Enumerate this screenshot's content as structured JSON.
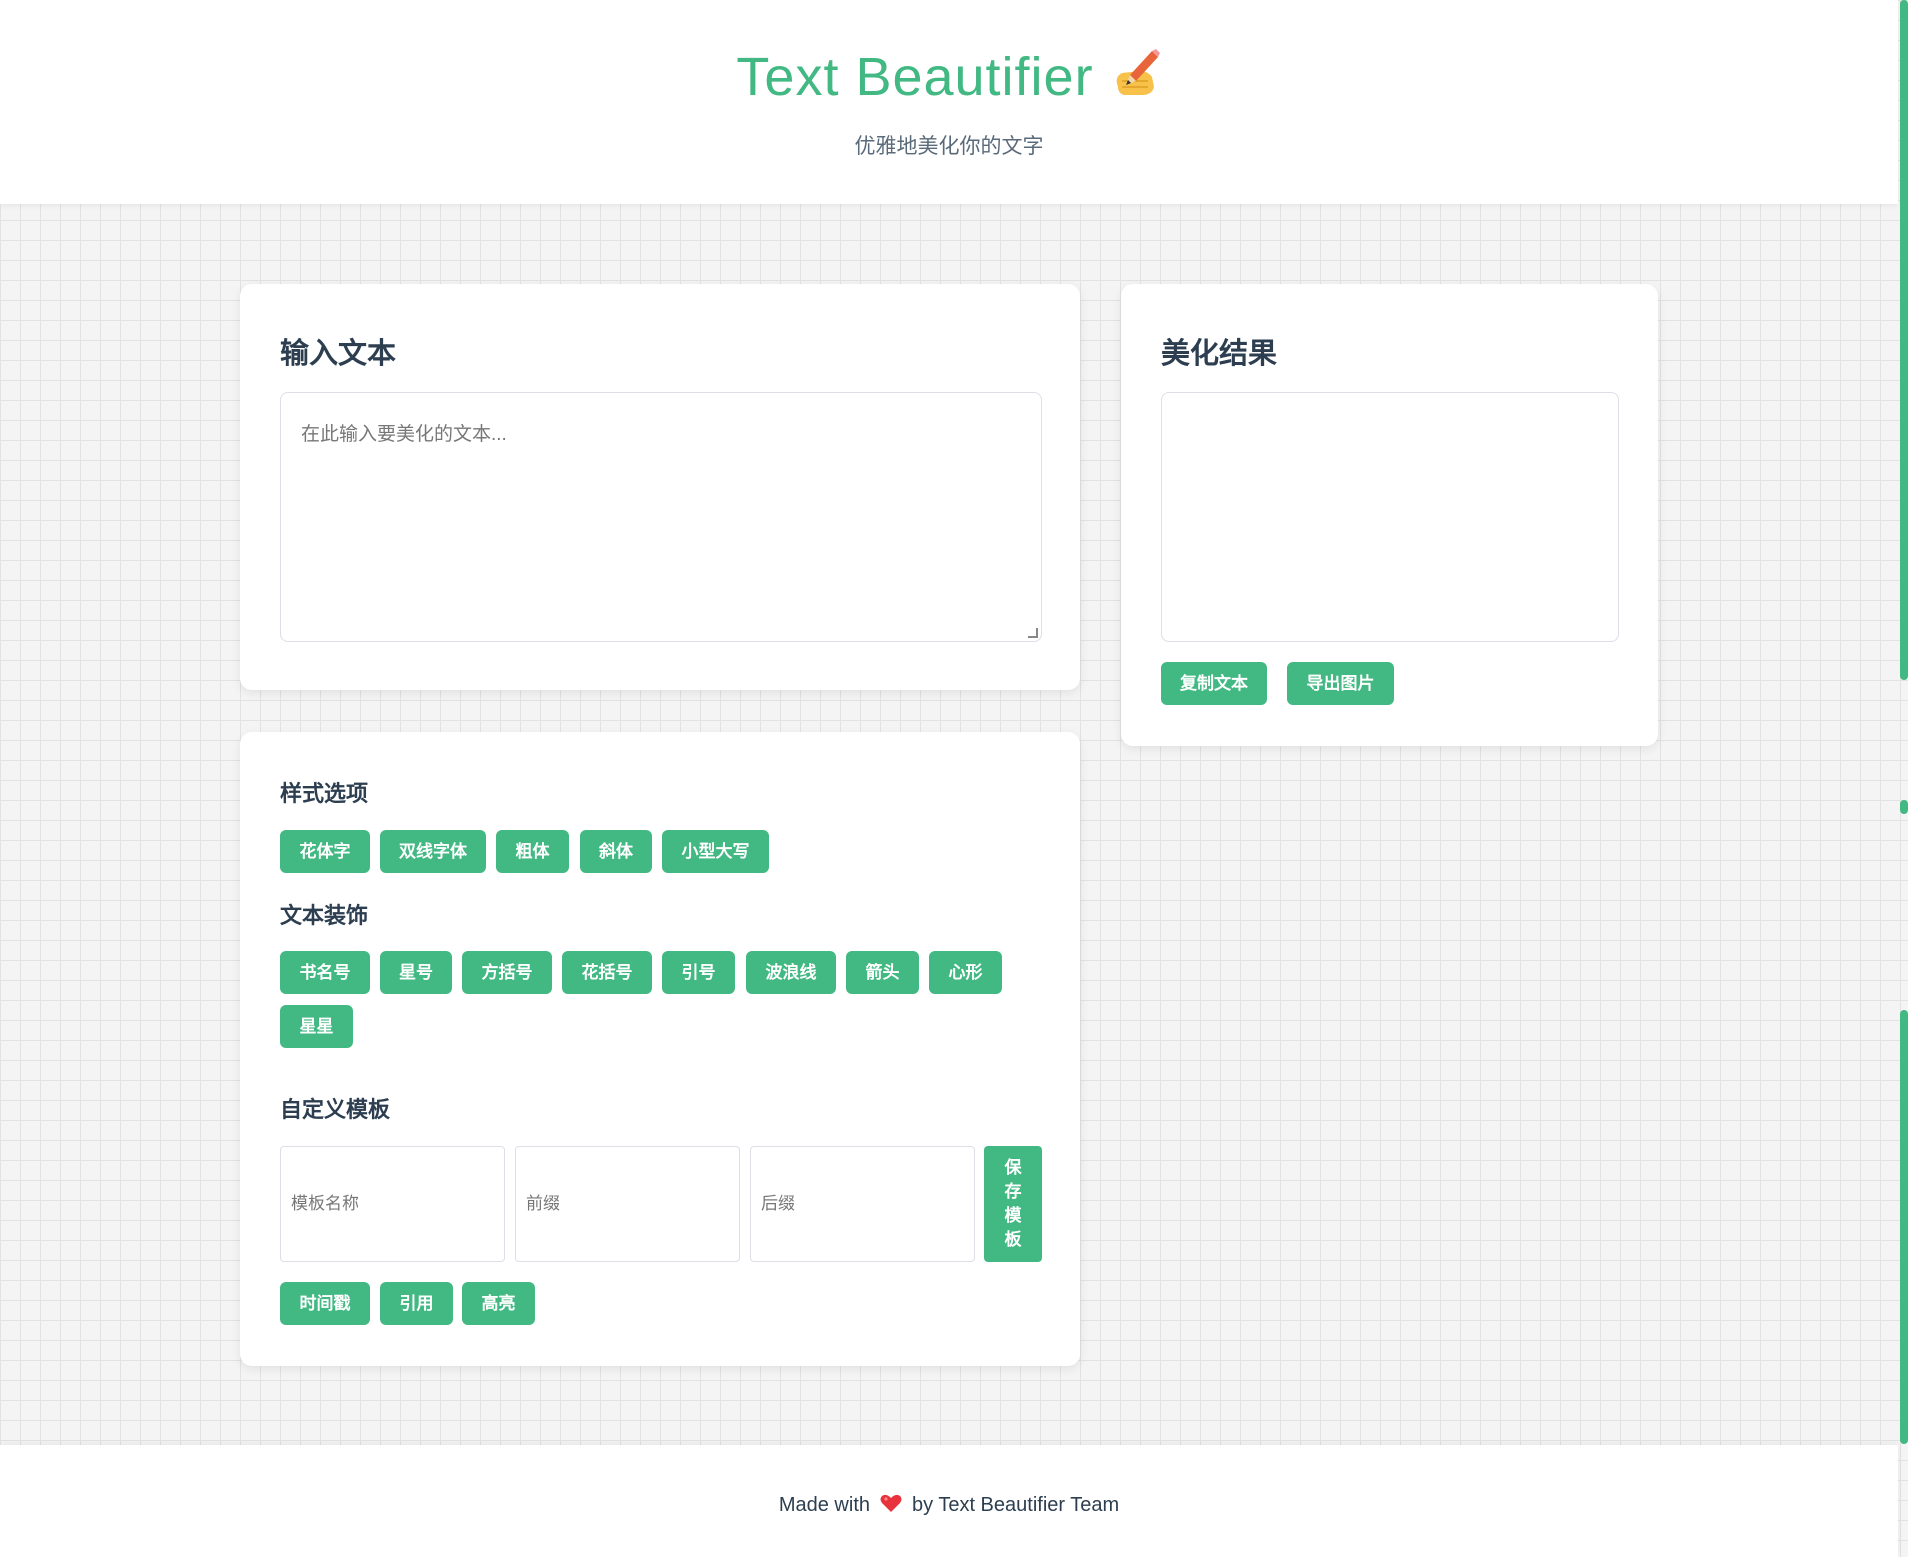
{
  "header": {
    "title": "Text Beautifier",
    "title_emoji": "✍️",
    "subtitle": "优雅地美化你的文字"
  },
  "input_card": {
    "heading": "输入文本",
    "placeholder": "在此输入要美化的文本..."
  },
  "output_card": {
    "heading": "美化结果",
    "result_text": "",
    "copy_label": "复制文本",
    "export_label": "导出图片"
  },
  "style_card": {
    "style_heading": "样式选项",
    "style_buttons": [
      "花体字",
      "双线字体",
      "粗体",
      "斜体",
      "小型大写"
    ],
    "decor_heading": "文本装饰",
    "decor_buttons": [
      "书名号",
      "星号",
      "方括号",
      "花括号",
      "引号",
      "波浪线",
      "箭头",
      "心形",
      "星星"
    ],
    "template_heading": "自定义模板",
    "template_name_placeholder": "模板名称",
    "prefix_placeholder": "前缀",
    "suffix_placeholder": "后缀",
    "save_label": "保存模板",
    "template_buttons": [
      "时间戳",
      "引用",
      "高亮"
    ]
  },
  "footer": {
    "before": "Made with",
    "after": "by Text Beautifier Team"
  },
  "colors": {
    "accent": "#42b883",
    "heading": "#2c3e50"
  }
}
